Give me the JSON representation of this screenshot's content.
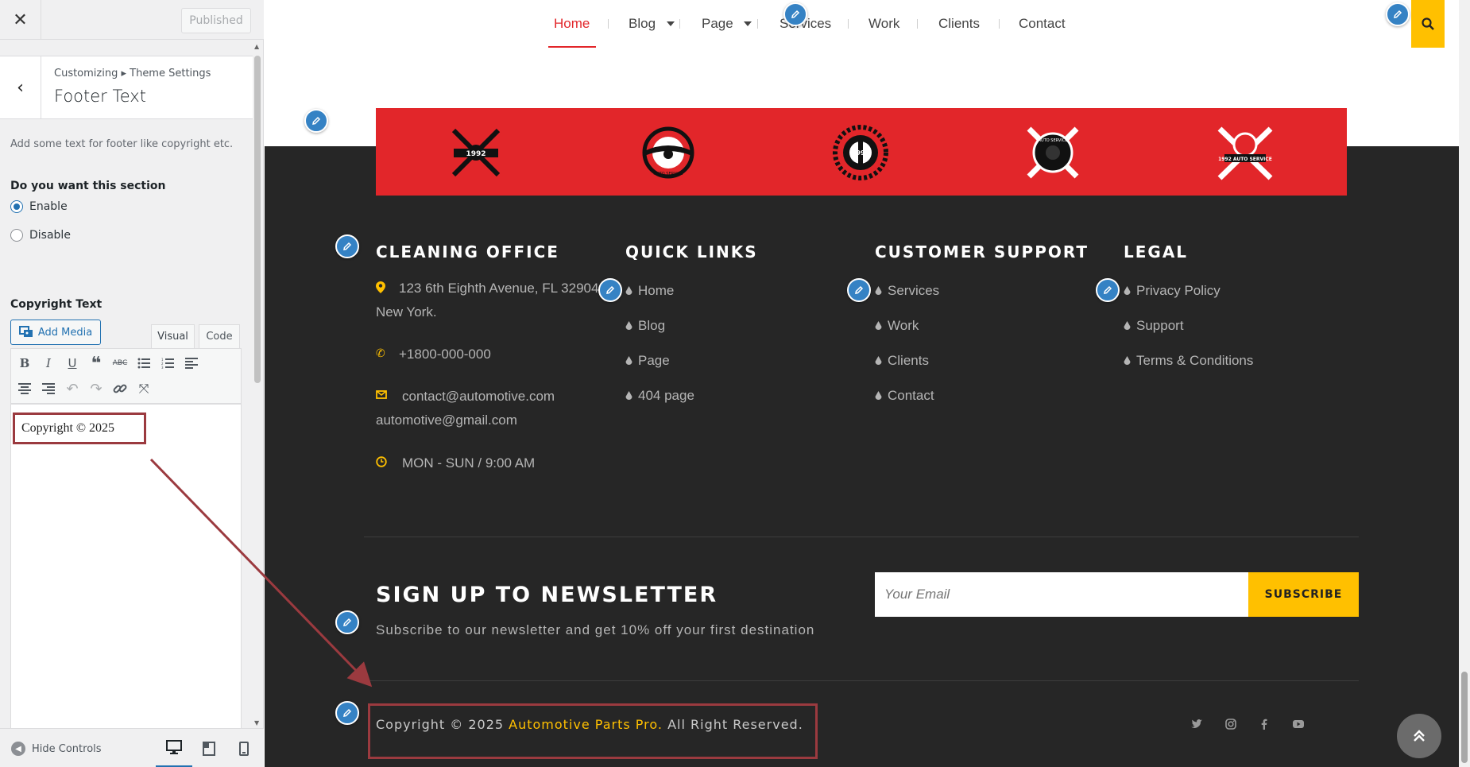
{
  "sidebar": {
    "close_icon": "close-icon",
    "published_label": "Published",
    "breadcrumb": "Customizing ▸ Theme Settings",
    "section_title": "Footer Text",
    "description": "Add some text for footer like copyright etc.",
    "section_question": "Do you want this section",
    "options": [
      {
        "label": "Enable",
        "checked": true
      },
      {
        "label": "Disable",
        "checked": false
      }
    ],
    "copyright_label": "Copyright Text",
    "add_media_label": "Add Media",
    "tabs": [
      {
        "label": "Visual",
        "active": true
      },
      {
        "label": "Code",
        "active": false
      }
    ],
    "toolbar": [
      "bold",
      "italic",
      "underline",
      "blockquote",
      "strikethrough",
      "bullet-list",
      "numbered-list",
      "align-left",
      "align-center",
      "align-right",
      "undo",
      "redo",
      "link",
      "fullscreen"
    ],
    "editor_content": "Copyright © 2025",
    "hide_controls_label": "Hide Controls",
    "devices": [
      "desktop",
      "tablet",
      "mobile"
    ]
  },
  "nav": {
    "items": [
      "Home",
      "Blog",
      "Page",
      "Services",
      "Work",
      "Clients",
      "Contact"
    ],
    "active": "Home"
  },
  "footer": {
    "partner_logo_texts": [
      "1992",
      "AUTO SERVICE",
      "1992",
      "AUTO SERVICE",
      "1992 AUTO SERVICE"
    ],
    "office": {
      "title": "CLEANING OFFICE",
      "address_line1": "123 6th Eighth Avenue, FL 32904, ,",
      "address_line2": "New York.",
      "phone": "+1800-000-000",
      "email1": "contact@automotive.com",
      "email2": "automotive@gmail.com",
      "hours": "MON - SUN / 9:00 AM"
    },
    "quick_links": {
      "title": "QUICK LINKS",
      "items": [
        "Home",
        "Blog",
        "Page",
        "404 page"
      ]
    },
    "support": {
      "title": "CUSTOMER SUPPORT",
      "items": [
        "Services",
        "Work",
        "Clients",
        "Contact"
      ]
    },
    "legal": {
      "title": "LEGAL",
      "items": [
        "Privacy Policy",
        "Support",
        "Terms & Conditions"
      ]
    },
    "newsletter": {
      "title": "SIGN UP TO NEWSLETTER",
      "subtitle": "Subscribe to our newsletter and get 10% off your first destination",
      "placeholder": "Your Email",
      "button": "SUBSCRIBE"
    },
    "copyright": {
      "prefix": "Copyright © 2025 ",
      "brand": "Automotive Parts Pro.",
      "suffix": " All Right Reserved."
    },
    "social": [
      "twitter-icon",
      "instagram-icon",
      "facebook-icon",
      "youtube-icon"
    ]
  },
  "colors": {
    "accent_red": "#e2262a",
    "accent_yellow": "#ffc000",
    "footer_bg": "#262626",
    "edit_blue": "#3582c4",
    "annotation": "#9b3a3f"
  }
}
